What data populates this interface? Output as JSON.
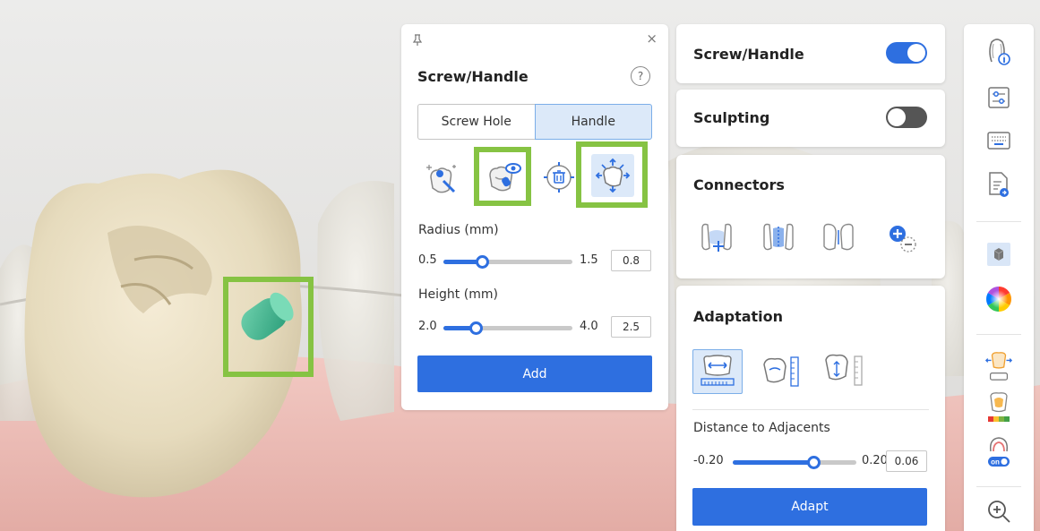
{
  "screw_handle_panel": {
    "title": "Screw/Handle",
    "help_label": "?",
    "close_label": "×",
    "tabs": [
      {
        "label": "Screw Hole",
        "selected": false
      },
      {
        "label": "Handle",
        "selected": true
      }
    ],
    "tools": [
      {
        "icon": "magic-select-tooth-icon",
        "highlighted": false
      },
      {
        "icon": "view-tooth-eye-icon",
        "highlighted": true
      },
      {
        "icon": "delete-target-icon",
        "highlighted": false
      },
      {
        "icon": "move-resize-arrows-icon",
        "highlighted": true
      }
    ],
    "radius": {
      "label": "Radius (mm)",
      "min": "0.5",
      "max": "1.5",
      "value": "0.8",
      "fraction": 0.3
    },
    "height": {
      "label": "Height (mm)",
      "min": "2.0",
      "max": "4.0",
      "value": "2.5",
      "fraction": 0.25
    },
    "add_label": "Add"
  },
  "right_panel": {
    "screw_handle": {
      "title": "Screw/Handle",
      "enabled": true
    },
    "sculpting": {
      "title": "Sculpting",
      "enabled": false
    },
    "connectors": {
      "title": "Connectors",
      "tools": [
        "add-connector-icon",
        "edit-connector-icon",
        "separate-connector-icon",
        "add-remove-connector-icon"
      ]
    },
    "adaptation": {
      "title": "Adaptation",
      "tools": [
        "adapt-width-icon",
        "adapt-contact-icon",
        "adapt-height-icon"
      ],
      "distance": {
        "label": "Distance to Adjacents",
        "min": "-0.20",
        "max": "0.20",
        "value": "0.06",
        "fraction": 0.65
      },
      "adapt_label": "Adapt"
    }
  },
  "toolbar": {
    "icons": [
      "jaw-info-icon",
      "adjust-sliders-icon",
      "keyboard-icon",
      "document-export-icon",
      "cube-view-icon",
      "color-wheel-icon",
      "tooth-transparency-icon",
      "tooth-color-map-icon",
      "tooth-on-icon",
      "zoom-in-icon"
    ],
    "on_badge": "on"
  },
  "colors": {
    "accent": "#2e6fe0",
    "highlight": "#86c343",
    "handle": "#3fb48f"
  }
}
